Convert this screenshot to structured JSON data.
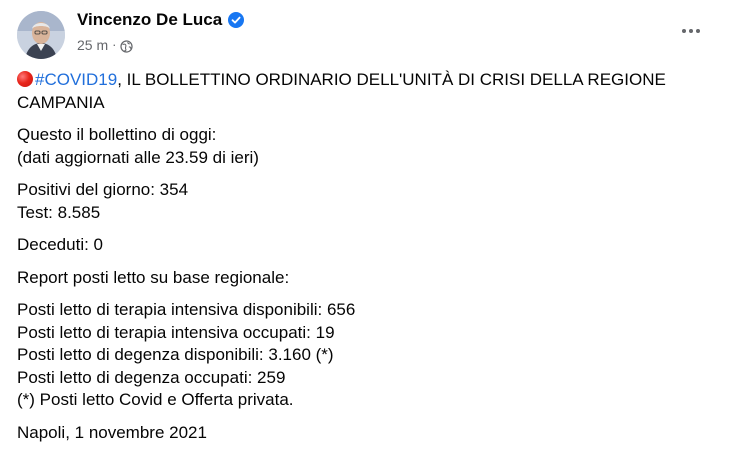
{
  "post": {
    "author": "Vincenzo De Luca",
    "time": "25 m",
    "meta_separator": "·",
    "icons": {
      "verified": "verified-badge-icon",
      "audience": "globe-icon",
      "more": "more-options-icon",
      "emoji": "red-circle-emoji-icon"
    },
    "colors": {
      "link": "#216fdb",
      "verified": "#1877f2",
      "secondary_text": "#65676b"
    },
    "headline": {
      "hashtag": "#COVID19",
      "rest_line1": ", IL BOLLETTINO ORDINARIO DELL'UNITÀ DI CRISI DELLA REGIONE",
      "line2": "CAMPANIA"
    },
    "intro": {
      "line1": "Questo il bollettino di oggi:",
      "line2": "(dati aggiornati alle 23.59 di ieri)"
    },
    "cases": {
      "positives": "Positivi del giorno: 354",
      "tests": "Test: 8.585"
    },
    "deaths": "Deceduti: 0",
    "report_title": "Report posti letto su base regionale:",
    "beds": [
      "Posti letto di terapia intensiva disponibili: 656",
      "Posti letto di terapia intensiva occupati: 19",
      "Posti letto di degenza disponibili: 3.160 (*)",
      "Posti letto di degenza occupati: 259",
      "(*) Posti letto Covid e Offerta privata."
    ],
    "signature": "Napoli, 1 novembre 2021"
  }
}
